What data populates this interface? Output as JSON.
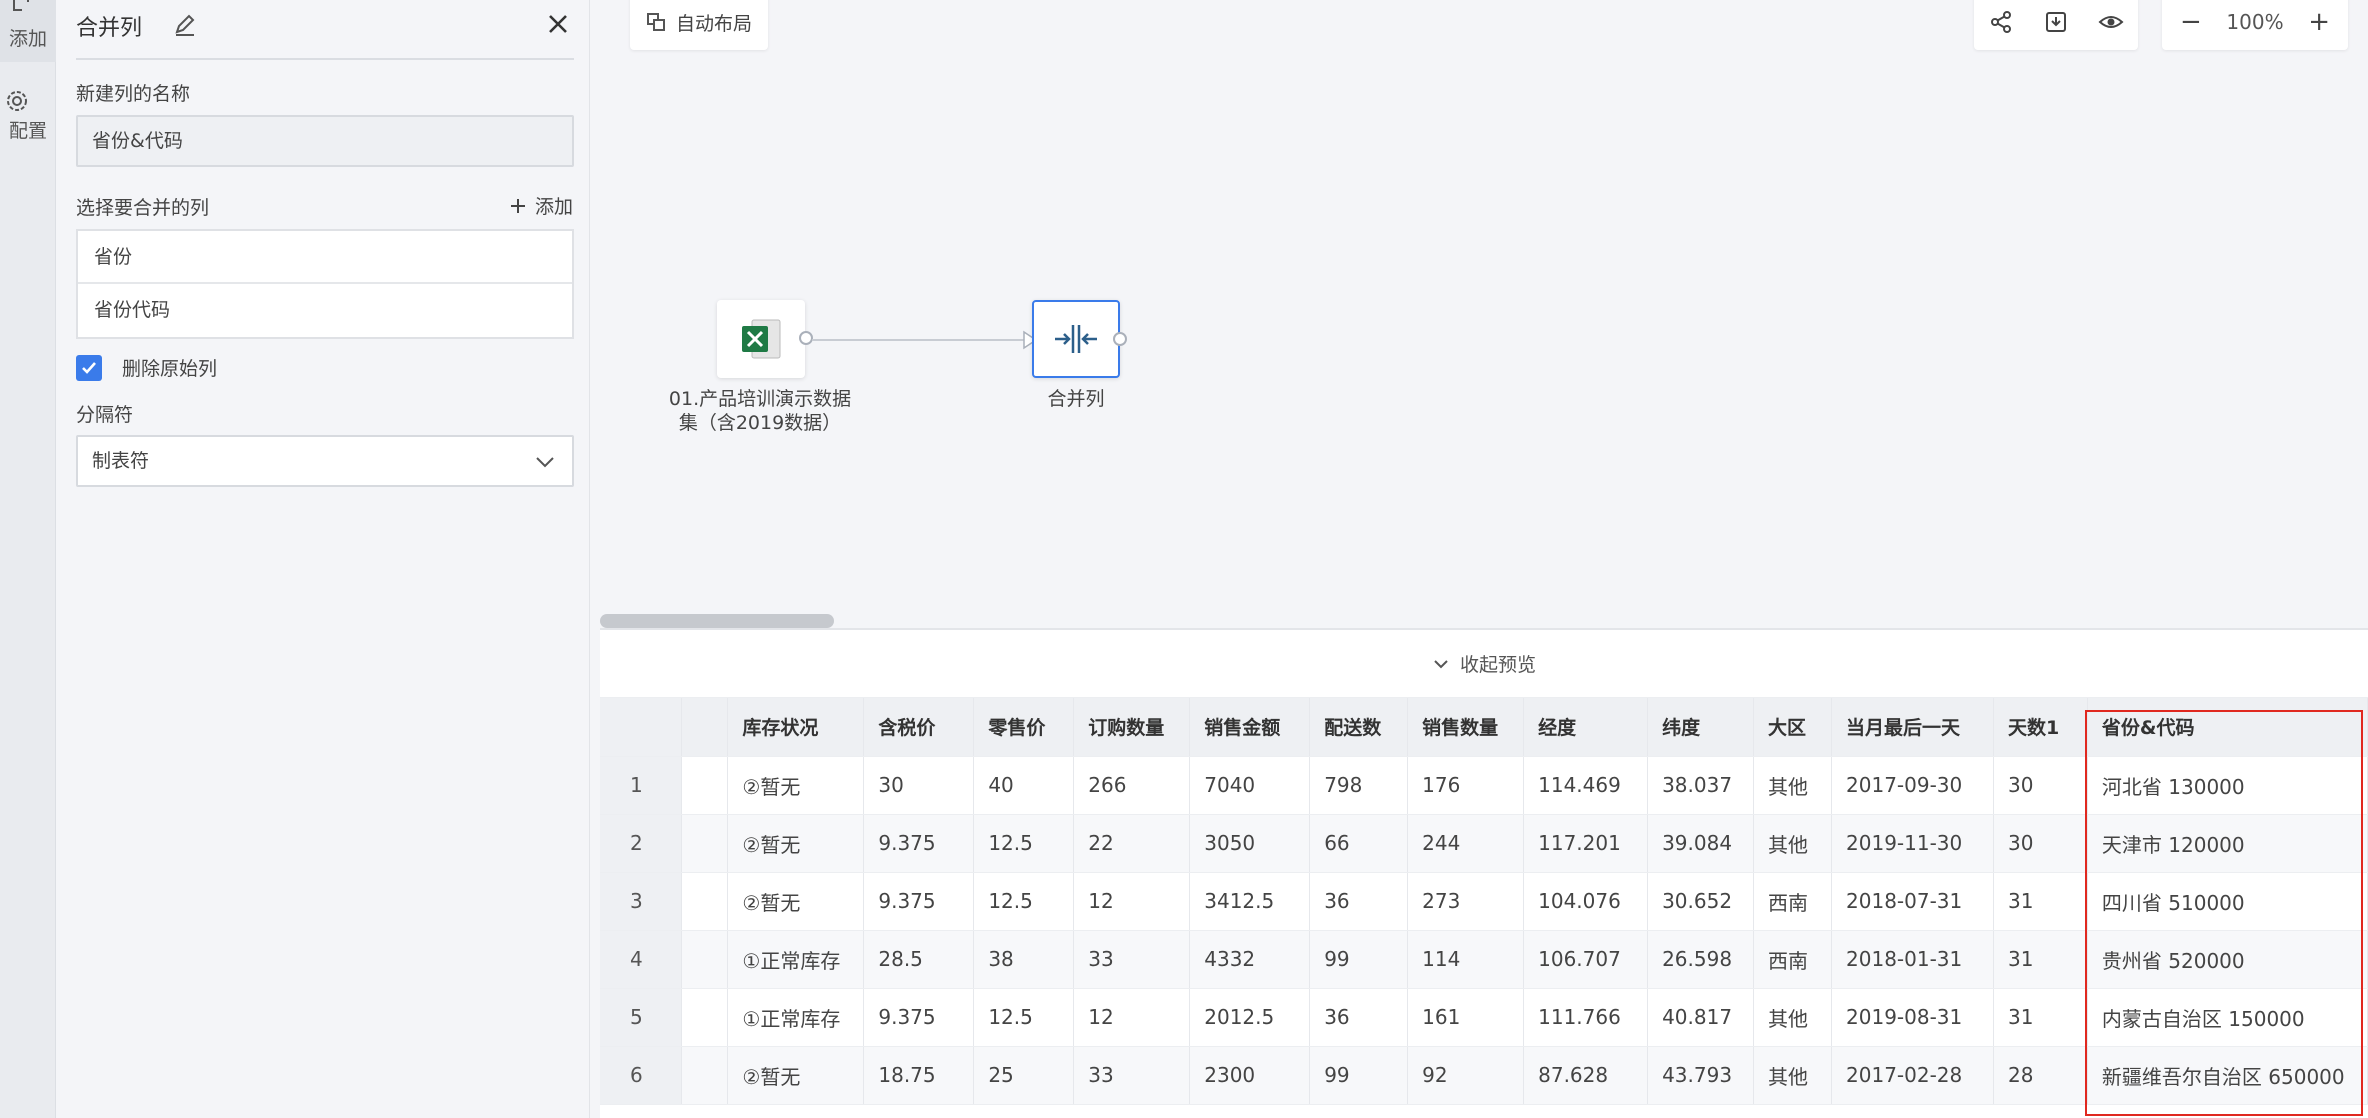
{
  "rail": {
    "add_label": "添加",
    "config_label": "配置"
  },
  "panel": {
    "title": "合并列",
    "new_col_label": "新建列的名称",
    "new_col_value": "省份&代码",
    "select_cols_label": "选择要合并的列",
    "add_label": "添加",
    "columns": [
      "省份",
      "省份代码"
    ],
    "delete_original_label": "删除原始列",
    "delete_original_checked": true,
    "separator_label": "分隔符",
    "separator_value": "制表符"
  },
  "canvas": {
    "auto_layout_label": "自动布局",
    "zoom_level": "100%",
    "zoom_out": "−",
    "zoom_in": "+",
    "source_node_label_line1": "01.产品培训演示数据",
    "source_node_label_line2": "集（含2019数据）",
    "merge_node_label": "合并列"
  },
  "preview": {
    "collapse_label": "收起预览",
    "headers": [
      "",
      "",
      "库存状况",
      "含税价",
      "零售价",
      "订购数量",
      "销售金额",
      "配送数",
      "销售数量",
      "经度",
      "纬度",
      "大区",
      "当月最后一天",
      "天数1",
      "省份&代码"
    ],
    "rows": [
      [
        "1",
        "",
        "②暂无",
        "30",
        "40",
        "266",
        "7040",
        "798",
        "176",
        "114.469",
        "38.037",
        "其他",
        "2017-09-30",
        "30",
        "河北省 130000"
      ],
      [
        "2",
        "",
        "②暂无",
        "9.375",
        "12.5",
        "22",
        "3050",
        "66",
        "244",
        "117.201",
        "39.084",
        "其他",
        "2019-11-30",
        "30",
        "天津市 120000"
      ],
      [
        "3",
        "",
        "②暂无",
        "9.375",
        "12.5",
        "12",
        "3412.5",
        "36",
        "273",
        "104.076",
        "30.652",
        "西南",
        "2018-07-31",
        "31",
        "四川省 510000"
      ],
      [
        "4",
        "",
        "①正常库存",
        "28.5",
        "38",
        "33",
        "4332",
        "99",
        "114",
        "106.707",
        "26.598",
        "西南",
        "2018-01-31",
        "31",
        "贵州省 520000"
      ],
      [
        "5",
        "",
        "①正常库存",
        "9.375",
        "12.5",
        "12",
        "2012.5",
        "36",
        "161",
        "111.766",
        "40.817",
        "其他",
        "2019-08-31",
        "31",
        "内蒙古自治区 150000"
      ],
      [
        "6",
        "",
        "②暂无",
        "18.75",
        "25",
        "33",
        "2300",
        "99",
        "92",
        "87.628",
        "43.793",
        "其他",
        "2017-02-28",
        "28",
        "新疆维吾尔自治区 650000"
      ]
    ]
  },
  "colors": {
    "accent": "#3a7bea",
    "highlight": "#e0281f",
    "excel_green": "#1f7a45"
  }
}
